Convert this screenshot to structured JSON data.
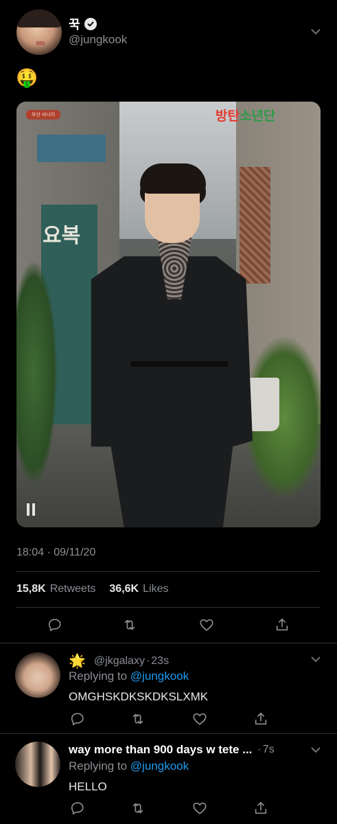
{
  "tweet": {
    "display_name": "꾹",
    "handle": "@jungkook",
    "body_emoji": "🤑",
    "timestamp": "18:04 · 09/11/20",
    "retweets_count": "15,8K",
    "retweets_label": "Retweets",
    "likes_count": "36,6K",
    "likes_label": "Likes",
    "photo": {
      "sign_korean": "요복",
      "logo_left": "방탄",
      "logo_right": "소년단",
      "small_tag": "부산 씨나이"
    }
  },
  "replies": [
    {
      "badge_emoji": "🌟",
      "name": "",
      "handle": "@jkgalaxy",
      "time": "23s",
      "replying_prefix": "Replying to",
      "replying_to": "@jungkook",
      "text": "OMGHSKDKSKDKSLXMK"
    },
    {
      "badge_emoji": "",
      "name": "way more than 900 days w tete ...",
      "handle": "",
      "time": "7s",
      "replying_prefix": "Replying to",
      "replying_to": "@jungkook",
      "text": "HELLO"
    }
  ],
  "colors": {
    "background": "#000000",
    "mention_blue": "#1d9bf0",
    "secondary_text": "#8b8f94",
    "divider": "#2f3336"
  },
  "icons": [
    "verified-icon",
    "chevron-down-icon",
    "reply-icon",
    "retweet-icon",
    "like-icon",
    "share-icon"
  ]
}
